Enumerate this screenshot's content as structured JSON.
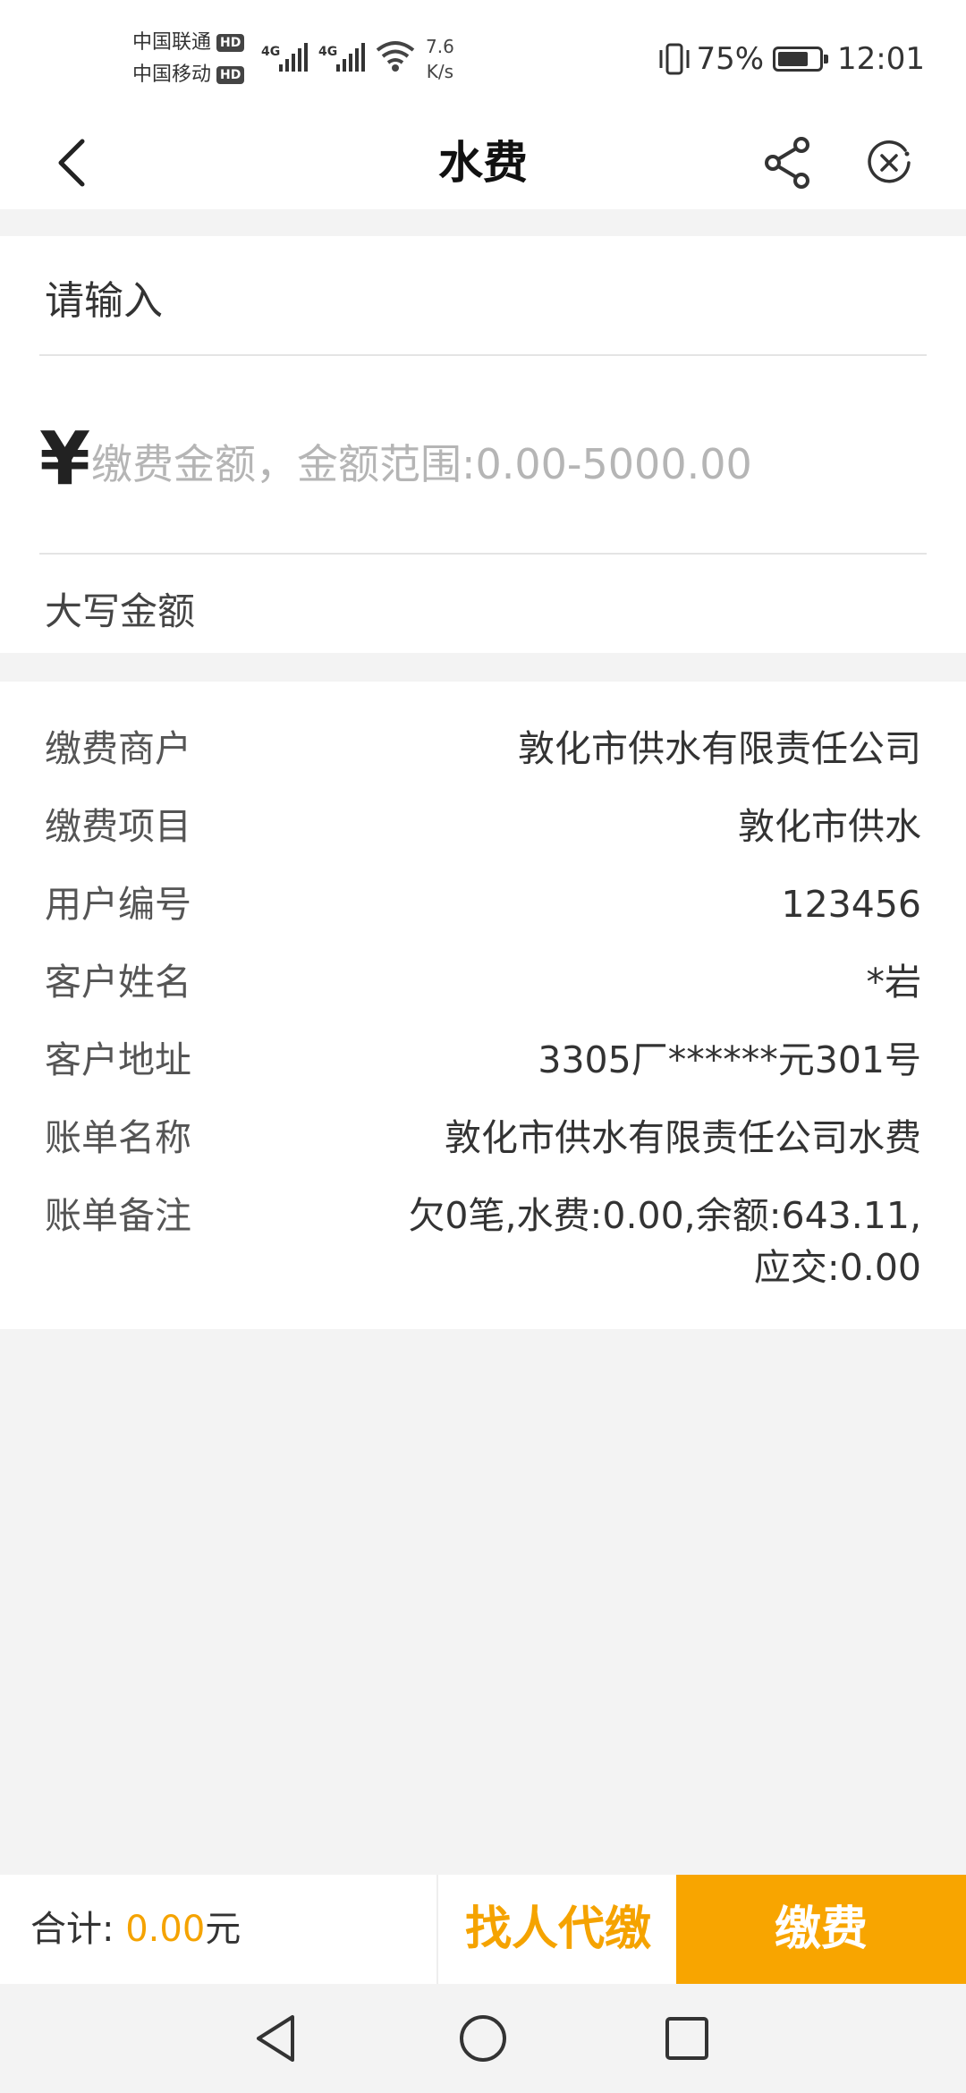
{
  "status_bar": {
    "carrier1": "中国联通",
    "carrier2": "中国移动",
    "hd_badge": "HD",
    "network1": "4G",
    "network2": "4G",
    "speed_value": "7.6",
    "speed_unit": "K/s",
    "battery": "75%",
    "battery_level": 0.75,
    "time": "12:01"
  },
  "header": {
    "title": "水费"
  },
  "input_section": {
    "prompt": "请输入",
    "currency_symbol": "¥",
    "amount_placeholder": "缴费金额，金额范围:0.00-5000.00",
    "amount_value": "",
    "capital_label": "大写金额"
  },
  "info": {
    "rows": [
      {
        "key": "缴费商户",
        "value": "敦化市供水有限责任公司"
      },
      {
        "key": "缴费项目",
        "value": "敦化市供水"
      },
      {
        "key": "用户编号",
        "value": "123456"
      },
      {
        "key": "客户姓名",
        "value": "*岩"
      },
      {
        "key": "客户地址",
        "value": "3305厂******元301号"
      },
      {
        "key": "账单名称",
        "value": "敦化市供水有限责任公司水费"
      },
      {
        "key": "账单备注",
        "value": "欠0笔,水费:0.00,余额:643.11,应交:0.00"
      }
    ]
  },
  "bottom_bar": {
    "total_label": "合计:",
    "total_amount": "0.00",
    "total_unit": "元",
    "proxy_pay_label": "找人代缴",
    "pay_label": "缴费"
  },
  "colors": {
    "accent": "#f8a500",
    "background": "#f3f3f3"
  }
}
